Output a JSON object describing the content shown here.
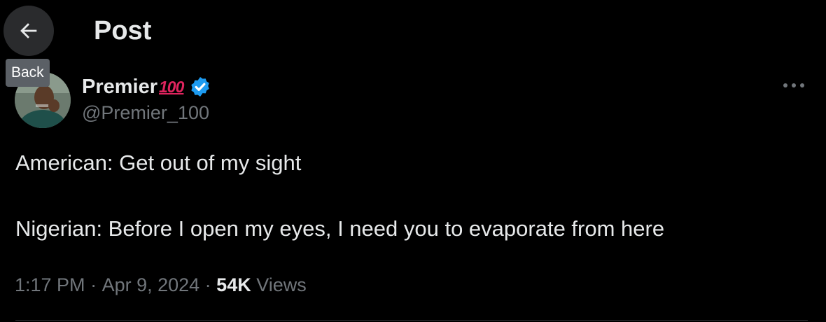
{
  "header": {
    "title": "Post",
    "back_tooltip": "Back"
  },
  "post": {
    "author": {
      "name": "Premier",
      "name_emoji": "100",
      "handle": "@Premier_100",
      "verified": true
    },
    "text_lines": [
      "American: Get out of my sight",
      "Nigerian: Before I open my eyes, I need you to evaporate from here"
    ],
    "meta": {
      "time": "1:17 PM",
      "separator": " · ",
      "date": "Apr 9, 2024",
      "views_count": "54K",
      "views_label": " Views"
    }
  },
  "colors": {
    "background": "#000000",
    "text_primary": "#e7e9ea",
    "text_secondary": "#71767b",
    "verified": "#1d9bf0",
    "emoji_red": "#e0245e",
    "tooltip_bg": "#5b6066"
  },
  "icons": {
    "back": "arrow-left-icon",
    "verified": "verified-badge-icon",
    "more": "more-horizontal-icon"
  }
}
